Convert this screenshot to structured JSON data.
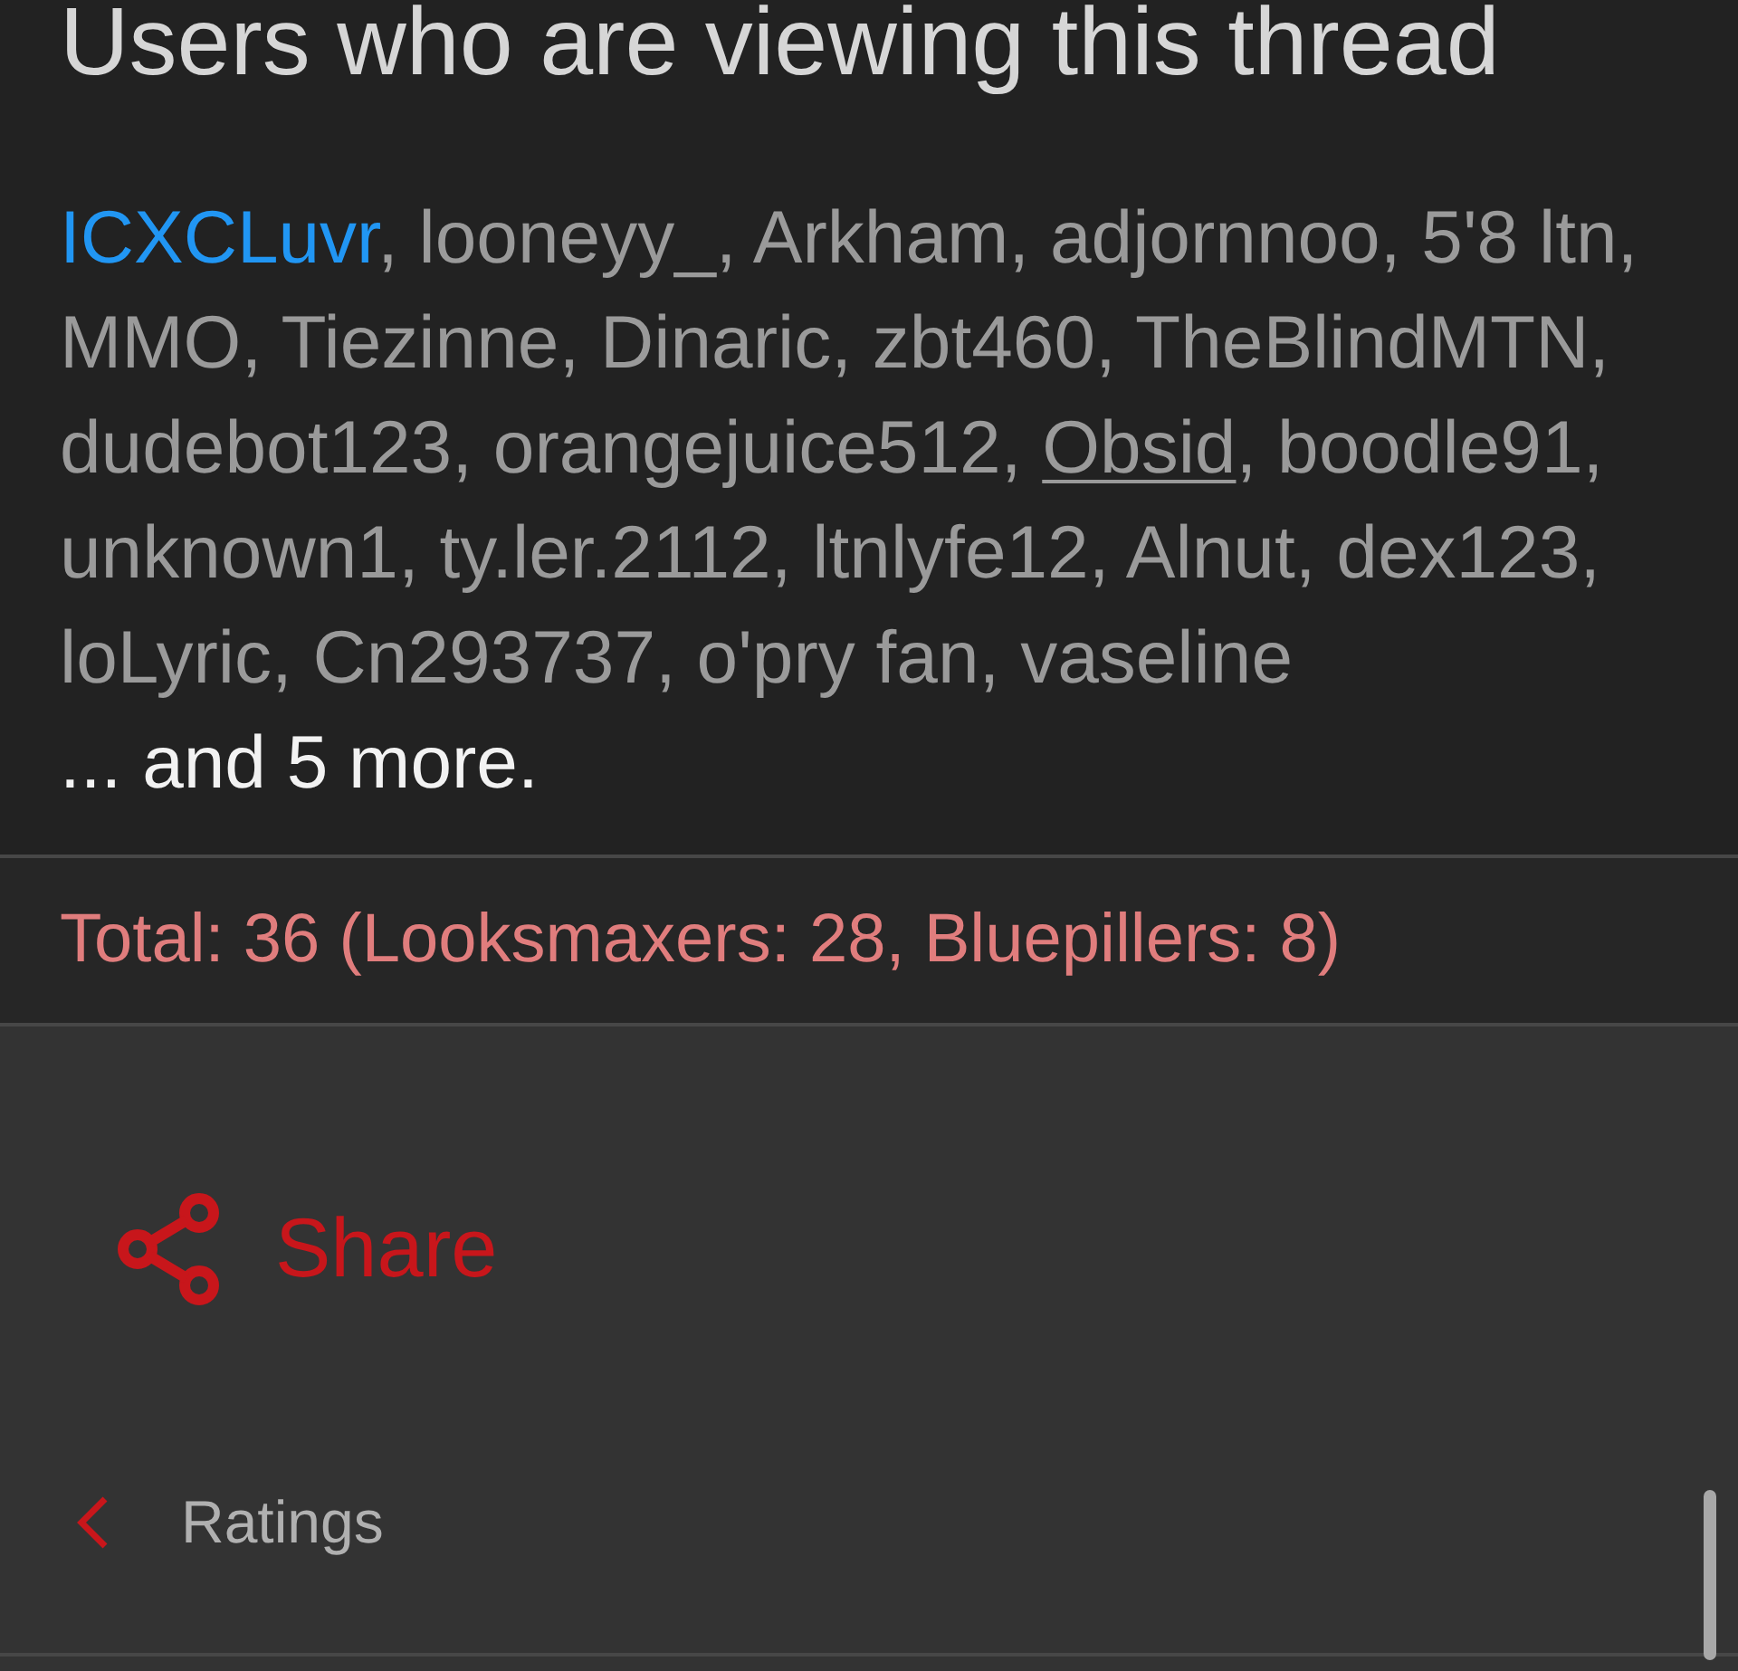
{
  "heading": "Users who are viewing this thread",
  "users": [
    {
      "name": "ICXCLuvr",
      "color": "#2196f3",
      "underlined": false
    },
    {
      "name": "looneyy_",
      "color": "#9a9a9a",
      "underlined": false
    },
    {
      "name": "Arkham",
      "color": "#9a9a9a",
      "underlined": false
    },
    {
      "name": "adjornnoo",
      "color": "#9a9a9a",
      "underlined": false
    },
    {
      "name": "5'8 ltn",
      "color": "#9a9a9a",
      "underlined": false
    },
    {
      "name": "MMO",
      "color": "#9a9a9a",
      "underlined": false
    },
    {
      "name": "Tiezinne",
      "color": "#9a9a9a",
      "underlined": false
    },
    {
      "name": "Dinaric",
      "color": "#9a9a9a",
      "underlined": false
    },
    {
      "name": "zbt460",
      "color": "#9a9a9a",
      "underlined": false
    },
    {
      "name": "TheBlindMTN",
      "color": "#9a9a9a",
      "underlined": false
    },
    {
      "name": "dudebot123",
      "color": "#9a9a9a",
      "underlined": false
    },
    {
      "name": "orangejuice512",
      "color": "#9a9a9a",
      "underlined": false
    },
    {
      "name": "Obsid",
      "color": "#9a9a9a",
      "underlined": true
    },
    {
      "name": "boodle91",
      "color": "#9a9a9a",
      "underlined": false
    },
    {
      "name": "unknown1",
      "color": "#9a9a9a",
      "underlined": false
    },
    {
      "name": "ty.ler.2112",
      "color": "#9a9a9a",
      "underlined": false
    },
    {
      "name": "ltnlyfe12",
      "color": "#9a9a9a",
      "underlined": false
    },
    {
      "name": "Alnut",
      "color": "#9a9a9a",
      "underlined": false
    },
    {
      "name": "dex123",
      "color": "#9a9a9a",
      "underlined": false
    },
    {
      "name": "loLyric",
      "color": "#9a9a9a",
      "underlined": false
    },
    {
      "name": "Cn293737",
      "color": "#9a9a9a",
      "underlined": false
    },
    {
      "name": "o'pry fan",
      "color": "#9a9a9a",
      "underlined": false
    },
    {
      "name": "vaseline",
      "color": "#9a9a9a",
      "underlined": false
    }
  ],
  "separator": ", ",
  "more": "... and 5 more.",
  "total": "Total: 36 (Looksmaxers: 28, Bluepillers: 8)",
  "share": {
    "label": "Share"
  },
  "breadcrumb": {
    "label": "Ratings"
  }
}
